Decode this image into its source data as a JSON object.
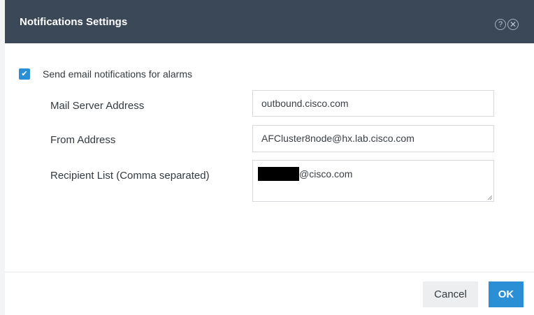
{
  "dialog": {
    "title": "Notifications Settings",
    "help_icon_glyph": "?",
    "close_icon_glyph": "✕"
  },
  "form": {
    "email_checkbox": {
      "label": "Send email notifications for alarms",
      "checked": true
    },
    "mail_server": {
      "label": "Mail Server Address",
      "value": "outbound.cisco.com"
    },
    "from_address": {
      "label": "From Address",
      "value": "AFCluster8node@hx.lab.cisco.com"
    },
    "recipient_list": {
      "label": "Recipient List (Comma separated)",
      "value_suffix": "@cisco.com"
    }
  },
  "footer": {
    "cancel_label": "Cancel",
    "ok_label": "OK"
  },
  "colors": {
    "header_bg": "#3b4858",
    "accent": "#2b8fd6"
  },
  "icons": [
    "help-icon",
    "close-icon",
    "checkmark-icon",
    "resize-grip-icon"
  ]
}
